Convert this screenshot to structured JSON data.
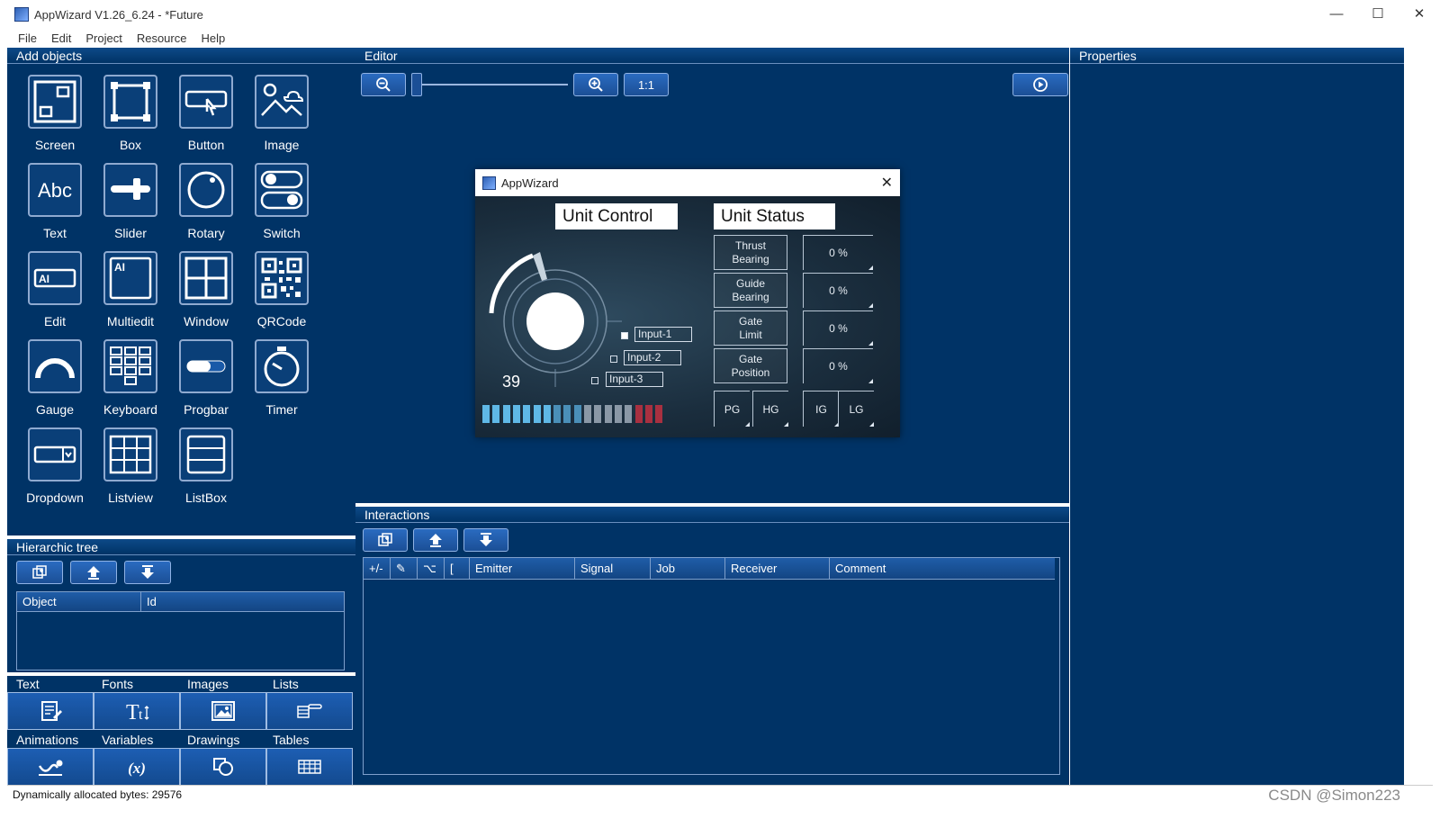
{
  "window": {
    "title": "AppWizard V1.26_6.24 - *Future",
    "minimize": "—",
    "maximize": "☐",
    "close": "✕"
  },
  "menu": [
    "File",
    "Edit",
    "Project",
    "Resource",
    "Help"
  ],
  "panels": {
    "add_objects": "Add objects",
    "editor": "Editor",
    "properties": "Properties",
    "hierarchic_tree": "Hierarchic tree",
    "interactions": "Interactions"
  },
  "objects": [
    "Screen",
    "Box",
    "Button",
    "Image",
    "Text",
    "Slider",
    "Rotary",
    "Switch",
    "Edit",
    "Multiedit",
    "Window",
    "QRCode",
    "Gauge",
    "Keyboard",
    "Progbar",
    "Timer",
    "Dropdown",
    "Listview",
    "ListBox"
  ],
  "tree_columns": [
    "Object",
    "Id"
  ],
  "resources_row1": [
    "Text",
    "Fonts",
    "Images",
    "Lists"
  ],
  "resources_row2": [
    "Animations",
    "Variables",
    "Drawings",
    "Tables"
  ],
  "editor_toolbar": {
    "one_to_one": "1:1"
  },
  "preview": {
    "title": "AppWizard",
    "close": "✕",
    "unit_control": "Unit Control",
    "unit_status": "Unit Status",
    "rotary_value": "39",
    "inputs": [
      "Input-1",
      "Input-2",
      "Input-3"
    ],
    "status_labels": [
      "Thrust\nBearing",
      "Guide\nBearing",
      "Gate\nLimit",
      "Gate\nPosition"
    ],
    "status_values": [
      "0 %",
      "0 %",
      "0 %",
      "0 %"
    ],
    "indicators": [
      "PG",
      "HG",
      "IG",
      "LG"
    ]
  },
  "interaction_columns": [
    "+/-",
    "✎",
    "⌥",
    "[",
    "Emitter",
    "Signal",
    "Job",
    "Receiver",
    "Comment"
  ],
  "status_bar": "Dynamically allocated bytes: 29576",
  "watermark": "CSDN @Simon223",
  "colors": {
    "panel_bg": "#003366",
    "accent": "#1b4f96"
  }
}
